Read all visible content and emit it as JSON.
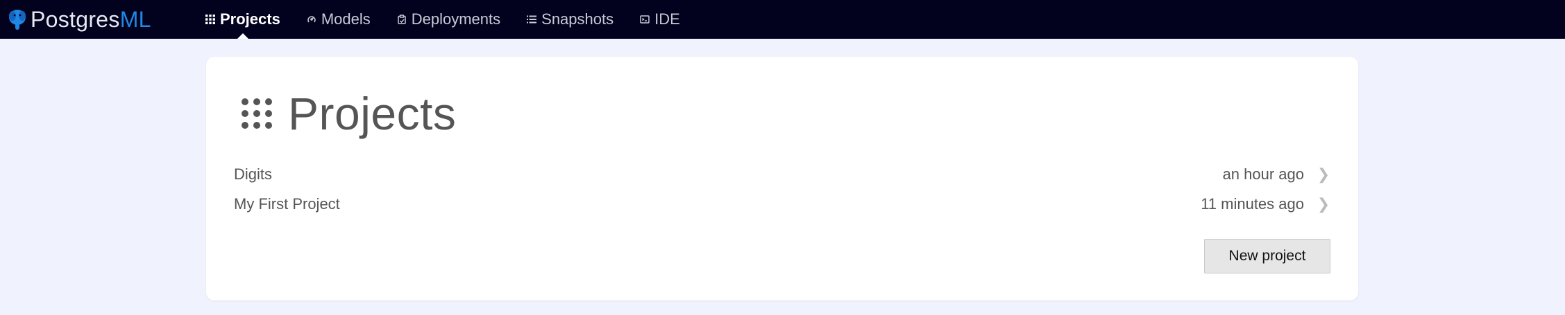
{
  "brand": {
    "name_part1": "Postgres",
    "name_part2": "ML"
  },
  "nav": [
    {
      "label": "Projects",
      "icon": "grid-icon",
      "active": true
    },
    {
      "label": "Models",
      "icon": "models-icon",
      "active": false
    },
    {
      "label": "Deployments",
      "icon": "deployments-icon",
      "active": false
    },
    {
      "label": "Snapshots",
      "icon": "list-icon",
      "active": false
    },
    {
      "label": "IDE",
      "icon": "terminal-icon",
      "active": false
    }
  ],
  "page": {
    "title": "Projects"
  },
  "projects": [
    {
      "name": "Digits",
      "updated": "an hour ago"
    },
    {
      "name": "My First Project",
      "updated": "11 minutes ago"
    }
  ],
  "actions": {
    "new_project_label": "New project"
  },
  "colors": {
    "topbar_bg": "#02021f",
    "page_bg": "#f0f2fe",
    "brand_accent": "#1e88e5",
    "card_bg": "#ffffff"
  }
}
